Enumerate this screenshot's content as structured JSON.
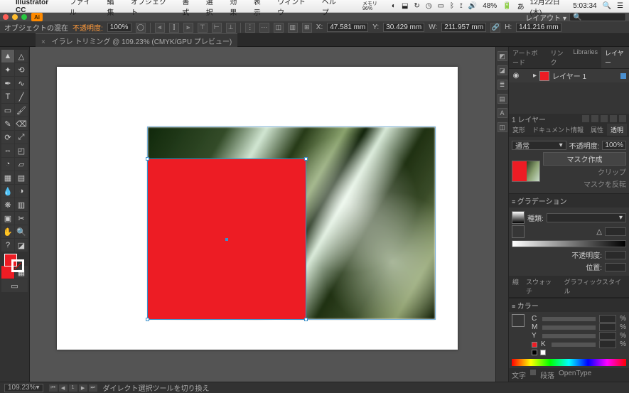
{
  "menubar": {
    "app_name": "Illustrator CC",
    "items": [
      "ファイル",
      "編集",
      "オブジェクト",
      "書式",
      "選択",
      "効果",
      "表示",
      "ウィンドウ",
      "ヘルプ"
    ],
    "memory": "メモリ 96%",
    "battery": "48%",
    "date": "12月22日(木)",
    "time": "5:03:34"
  },
  "app_row": {
    "ai_badge": "Ai",
    "layout_label": "レイアウト ▾",
    "search_placeholder": "🔍"
  },
  "control_bar": {
    "selection_label": "オブジェクトの混在",
    "opacity_label": "不透明度:",
    "opacity_value": "100%",
    "x_label": "X:",
    "x_value": "47.581 mm",
    "y_label": "Y:",
    "y_value": "30.429 mm",
    "w_label": "W:",
    "w_value": "211.957 mm",
    "h_label": "H:",
    "h_value": "141.216 mm"
  },
  "doc_tab": {
    "title": "イラレ トリミング @ 109.23% (CMYK/GPU プレビュー)"
  },
  "layers_panel": {
    "tabs": [
      "アートボード",
      "リンク",
      "Libraries",
      "レイヤー"
    ],
    "layer1": "レイヤー 1",
    "footer": "1 レイヤー"
  },
  "transparency_panel": {
    "tabs": [
      "変形",
      "ドキュメント情報",
      "属性",
      "透明"
    ],
    "blend_mode": "通常",
    "opacity_label": "不透明度:",
    "opacity_value": "100%",
    "actions": {
      "make_mask": "マスク作成",
      "clip": "クリップ",
      "invert": "マスクを反転"
    }
  },
  "gradient_panel": {
    "header": "グラデーション",
    "type_label": "種類:",
    "opacity_label": "不透明度:",
    "position_label": "位置:"
  },
  "color_panel": {
    "tabs": [
      "線",
      "スウォッチ",
      "グラフィックスタイル"
    ],
    "header": "カラー",
    "channels": [
      "C",
      "M",
      "Y",
      "K"
    ],
    "pct": "%"
  },
  "bottom_tabs": {
    "items": [
      "文字",
      "段落",
      "OpenType"
    ]
  },
  "status_bar": {
    "zoom": "109.23%",
    "hint": "ダイレクト選択ツールを切り換え"
  },
  "icons": {
    "apple": "",
    "eye": "👁",
    "dropdown": "▾",
    "search": "🔍",
    "close": "×",
    "first": "⏮",
    "prev": "◀",
    "next": "▶",
    "last": "⏭"
  }
}
